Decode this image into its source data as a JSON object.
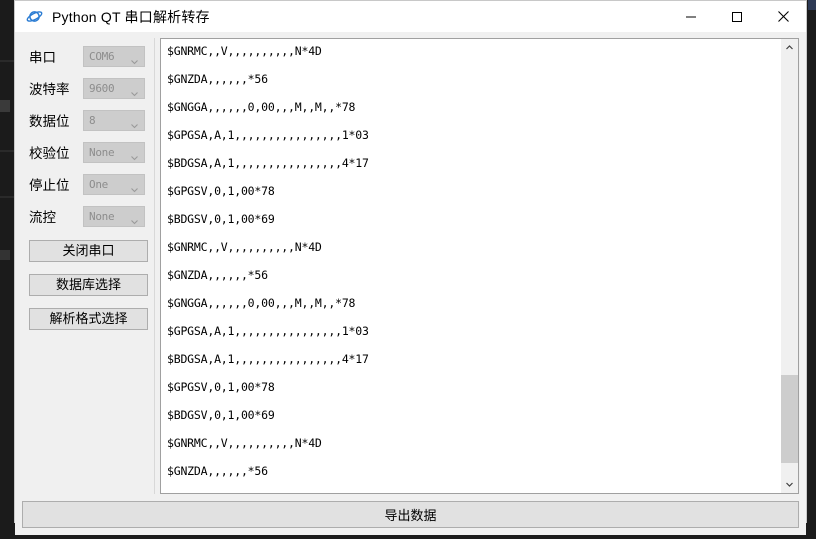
{
  "window": {
    "title": "Python QT 串口解析转存",
    "icon": "planet-icon",
    "controls": {
      "minimize": "minimize-icon",
      "maximize": "maximize-icon",
      "close": "close-icon"
    }
  },
  "sidebar": {
    "fields": [
      {
        "label": "串口",
        "value": "COM6",
        "name": "serial-port",
        "enabled": false
      },
      {
        "label": "波特率",
        "value": "9600",
        "name": "baud-rate",
        "enabled": false
      },
      {
        "label": "数据位",
        "value": "8",
        "name": "data-bits",
        "enabled": false
      },
      {
        "label": "校验位",
        "value": "None",
        "name": "parity",
        "enabled": false
      },
      {
        "label": "停止位",
        "value": "One",
        "name": "stop-bits",
        "enabled": false
      },
      {
        "label": "流控",
        "value": "None",
        "name": "flow-control",
        "enabled": false
      }
    ],
    "buttons": [
      {
        "label": "关闭串口",
        "name": "close-serial-button"
      },
      {
        "label": "数据库选择",
        "name": "database-select-button"
      },
      {
        "label": "解析格式选择",
        "name": "parse-format-select-button"
      }
    ]
  },
  "text_view": {
    "lines": [
      "$GNRMC,,V,,,,,,,,,,N*4D",
      "$GNZDA,,,,,,*56",
      "$GNGGA,,,,,,0,00,,,M,,M,,*78",
      "$GPGSA,A,1,,,,,,,,,,,,,,,,1*03",
      "$BDGSA,A,1,,,,,,,,,,,,,,,,4*17",
      "$GPGSV,0,1,00*78",
      "$BDGSV,0,1,00*69",
      "$GNRMC,,V,,,,,,,,,,N*4D",
      "$GNZDA,,,,,,*56",
      "$GNGGA,,,,,,0,00,,,M,,M,,*78",
      "$GPGSA,A,1,,,,,,,,,,,,,,,,1*03",
      "$BDGSA,A,1,,,,,,,,,,,,,,,,4*17",
      "$GPGSV,0,1,00*78",
      "$BDGSV,0,1,00*69",
      "$GNRMC,,V,,,,,,,,,,N*4D",
      "$GNZDA,,,,,,*56"
    ],
    "scrollbar": {
      "up_arrow": "chevron-up-icon",
      "down_arrow": "chevron-down-icon",
      "thumb_top_pct": 76,
      "thumb_height_pct": 21
    }
  },
  "footer": {
    "export_label": "导出数据"
  },
  "colors": {
    "window_bg": "#f0f0f0",
    "text_bg": "#ffffff",
    "button_bg": "#e1e1e1",
    "button_border": "#adadad",
    "combo_disabled_bg": "#cdcdcd",
    "combo_disabled_text": "#8d8d8d",
    "title_icon": "#2b7cd3",
    "desktop": "#1b1b1b"
  }
}
